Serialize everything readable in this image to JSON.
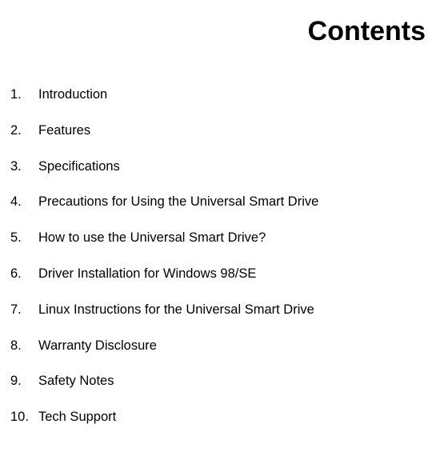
{
  "title": "Contents",
  "items": [
    {
      "num": "1.",
      "label": "Introduction"
    },
    {
      "num": "2.",
      "label": "Features"
    },
    {
      "num": "3.",
      "label": "Specifications"
    },
    {
      "num": "4.",
      "label": "Precautions for Using the Universal Smart Drive"
    },
    {
      "num": "5.",
      "label": "How to use the Universal Smart Drive?"
    },
    {
      "num": "6.",
      "label": "Driver Installation for Windows 98/SE"
    },
    {
      "num": "7.",
      "label": "Linux Instructions for the Universal Smart Drive"
    },
    {
      "num": "8.",
      "label": "Warranty Disclosure"
    },
    {
      "num": "9.",
      "label": "Safety Notes"
    },
    {
      "num": "10.",
      "label": "Tech Support"
    }
  ]
}
